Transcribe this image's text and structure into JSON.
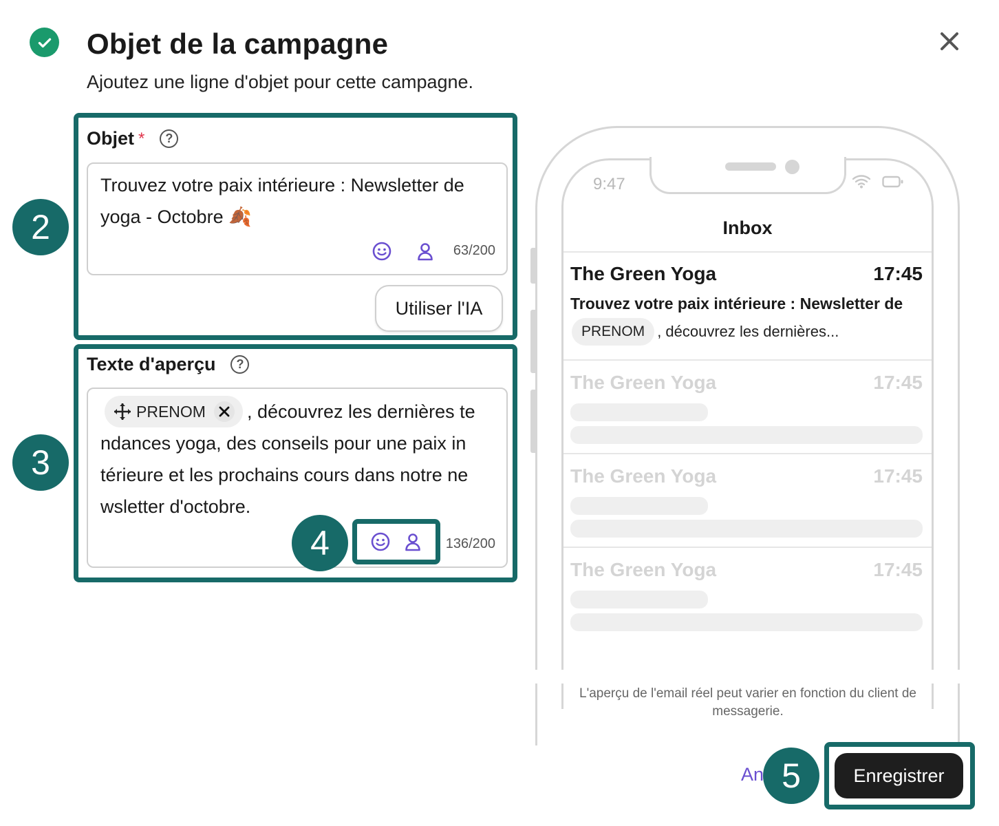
{
  "header": {
    "title": "Objet de la campagne",
    "subtitle": "Ajoutez une ligne d'objet pour cette campagne."
  },
  "subject": {
    "label": "Objet",
    "required_mark": "*",
    "value_line1": "Trouvez votre paix intérieure : Newsletter de",
    "value_line2": "yoga - Octobre 🍂",
    "count": "63/200",
    "ai_button": "Utiliser l'IA"
  },
  "preview_text": {
    "label": "Texte d'aperçu",
    "chip": "PRENOM",
    "line1_rest": ", découvrez les dernières te",
    "line2": "ndances yoga, des conseils pour une paix in",
    "line3": "térieure et les prochains cours dans notre ne",
    "line4": "wsletter d'octobre.",
    "count": "136/200"
  },
  "annotations": {
    "step2": "2",
    "step3": "3",
    "step4": "4",
    "step5": "5"
  },
  "phone": {
    "time": "9:47",
    "inbox_title": "Inbox",
    "emails": [
      {
        "sender": "The Green Yoga",
        "time": "17:45",
        "subject": "Trouvez votre paix intérieure : Newsletter de yoga - Octobre",
        "chip": "PRENOM",
        "preview": ", découvrez les dernières..."
      },
      {
        "sender": "The Green Yoga",
        "time": "17:45"
      },
      {
        "sender": "The Green Yoga",
        "time": "17:45"
      },
      {
        "sender": "The Green Yoga",
        "time": "17:45"
      }
    ]
  },
  "disclaimer": "L'aperçu de l'email réel peut varier en fonction du client de messagerie.",
  "footer": {
    "cancel_label": "An",
    "save_label": "Enregistrer"
  },
  "colors": {
    "accent_teal": "#176a68",
    "check_green": "#1a9a6c",
    "icon_purple": "#6a4fd0",
    "required_red": "#e0344b"
  }
}
